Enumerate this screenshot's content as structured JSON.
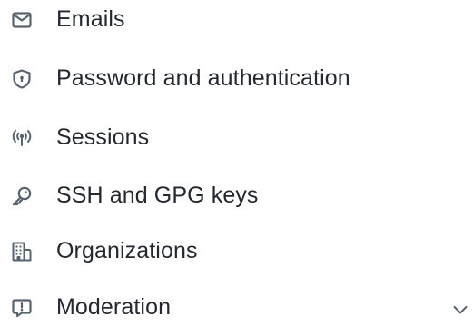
{
  "nav": {
    "items": [
      {
        "label": "Emails",
        "icon": "mail-icon"
      },
      {
        "label": "Password and authentication",
        "icon": "shield-lock-icon"
      },
      {
        "label": "Sessions",
        "icon": "broadcast-icon"
      },
      {
        "label": "SSH and GPG keys",
        "icon": "key-icon"
      },
      {
        "label": "Organizations",
        "icon": "organization-icon"
      },
      {
        "label": "Moderation",
        "icon": "report-icon",
        "expandable": true
      }
    ]
  }
}
